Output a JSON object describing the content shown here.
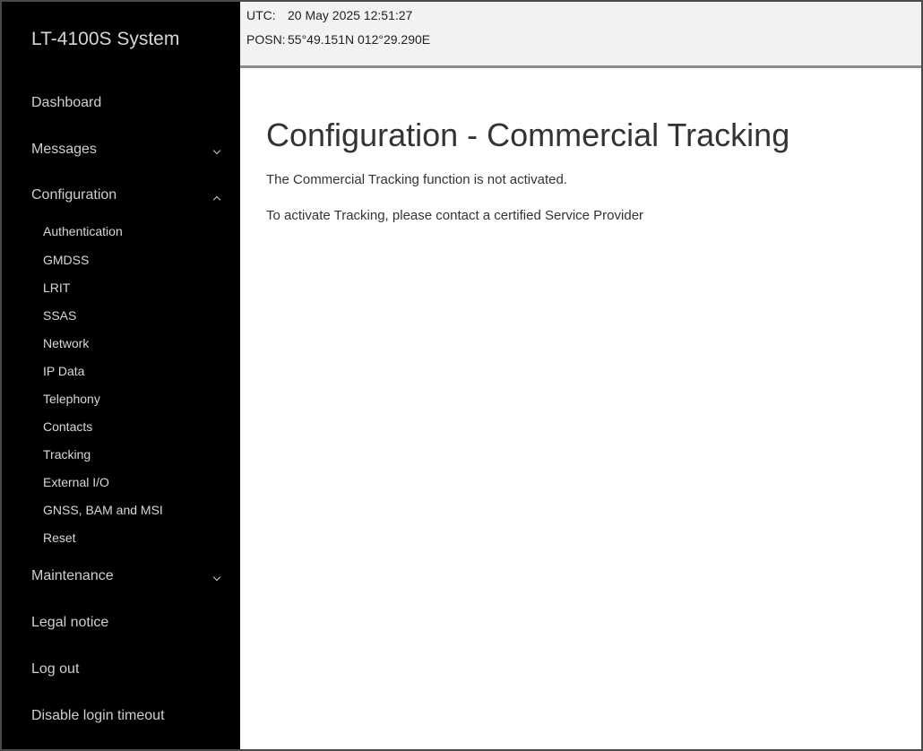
{
  "sidebar": {
    "brand": "LT-4100S System",
    "items": [
      {
        "label": "Dashboard"
      },
      {
        "label": "Messages"
      },
      {
        "label": "Configuration"
      },
      {
        "label": "Maintenance"
      },
      {
        "label": "Legal notice"
      },
      {
        "label": "Log out"
      },
      {
        "label": "Disable login timeout"
      }
    ],
    "config_sub": [
      "Authentication",
      "GMDSS",
      "LRIT",
      "SSAS",
      "Network",
      "IP Data",
      "Telephony",
      "Contacts",
      "Tracking",
      "External I/O",
      "GNSS, BAM and MSI",
      "Reset"
    ]
  },
  "header": {
    "utc_label": "UTC:",
    "utc_value": "20 May 2025 12:51:27",
    "posn_label": "POSN:",
    "posn_value": "55°49.151N 012°29.290E"
  },
  "main": {
    "title": "Configuration - Commercial Tracking",
    "para1": "The Commercial Tracking function is not activated.",
    "para2": "To activate Tracking, please contact a certified Service Provider"
  },
  "colors": {
    "sidebar_bg": "#000000",
    "header_bg": "#f2f2f2",
    "header_border": "#8c8c8c"
  },
  "icons": {
    "messages": "chevron-down-icon",
    "configuration": "chevron-up-icon",
    "maintenance": "chevron-down-icon"
  }
}
